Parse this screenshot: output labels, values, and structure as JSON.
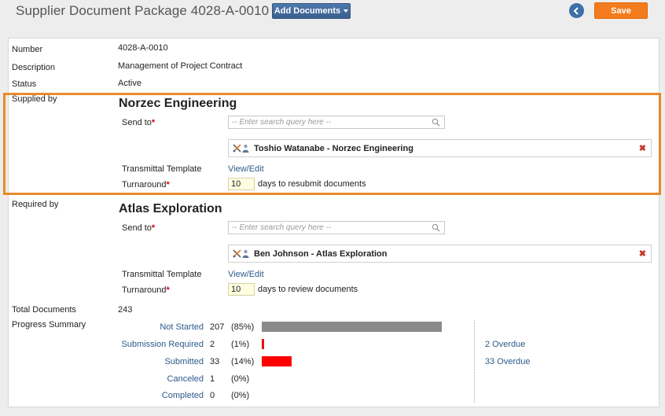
{
  "header": {
    "title": "Supplier Document Package 4028-A-0010",
    "add_documents_label": "Add Documents",
    "save_label": "Save"
  },
  "fields": {
    "number_label": "Number",
    "number_value": "4028-A-0010",
    "description_label": "Description",
    "description_value": "Management of Project Contract",
    "status_label": "Status",
    "status_value": "Active",
    "supplied_by_label": "Supplied by",
    "required_by_label": "Required by",
    "total_documents_label": "Total Documents",
    "total_documents_value": "243",
    "progress_summary_label": "Progress Summary"
  },
  "supplied_by": {
    "org": "Norzec Engineering",
    "send_to_label": "Send to",
    "search_placeholder": "-- Enter search query here --",
    "contact": "Toshio Watanabe - Norzec Engineering",
    "transmittal_label": "Transmittal Template",
    "transmittal_link": "View/Edit",
    "turnaround_label": "Turnaround",
    "turnaround_value": "10",
    "turnaround_text": "days to resubmit documents"
  },
  "required_by": {
    "org": "Atlas Exploration",
    "send_to_label": "Send to",
    "search_placeholder": "-- Enter search query here --",
    "contact": "Ben Johnson - Atlas Exploration",
    "transmittal_label": "Transmittal Template",
    "transmittal_link": "View/Edit",
    "turnaround_label": "Turnaround",
    "turnaround_value": "10",
    "turnaround_text": "days to review documents"
  },
  "progress": [
    {
      "label": "Not Started",
      "count": "207",
      "pct": "(85%)",
      "fraction": 0.85,
      "color": "#8a8a8a",
      "overdue": ""
    },
    {
      "label": "Submission Required",
      "count": "2",
      "pct": "(1%)",
      "fraction": 0.01,
      "color": "#e8120c",
      "overdue": "2 Overdue"
    },
    {
      "label": "Submitted",
      "count": "33",
      "pct": "(14%)",
      "fraction": 0.14,
      "color": "#ff0000",
      "overdue": "33 Overdue"
    },
    {
      "label": "Canceled",
      "count": "1",
      "pct": "(0%)",
      "fraction": 0,
      "color": "#8a8a8a",
      "overdue": ""
    },
    {
      "label": "Completed",
      "count": "0",
      "pct": "(0%)",
      "fraction": 0,
      "color": "#8a8a8a",
      "overdue": ""
    }
  ],
  "colors": {
    "accent_save": "#f47c1e",
    "primary_button": "#3a5f8e",
    "highlight_border": "#e88a2a",
    "link": "#2c5a8a"
  },
  "icons": {
    "back": "chevron-left-circle-icon",
    "search": "magnifier-icon",
    "remove": "remove-x-icon",
    "contact_type": "tools-icon",
    "contact_person": "person-icon"
  }
}
